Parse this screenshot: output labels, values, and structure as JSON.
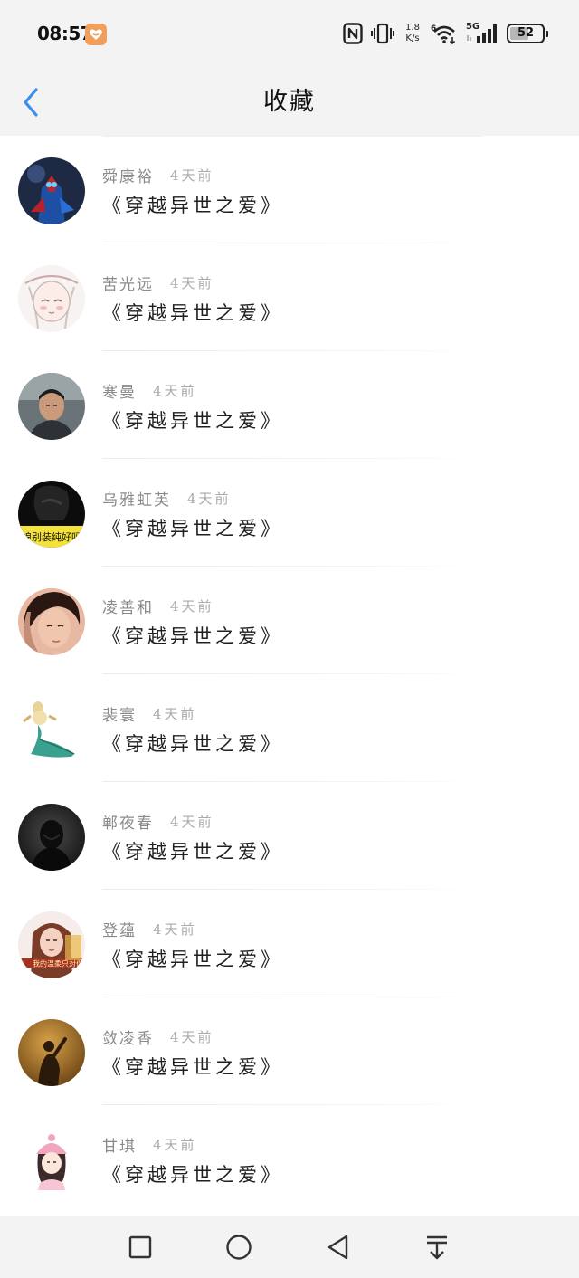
{
  "status_bar": {
    "time": "08:57",
    "net_speed_value": "1.8",
    "net_speed_unit": "K/s",
    "network_type": "5G",
    "battery_percent": "52",
    "icons": [
      "app-notification-icon",
      "nfc-icon",
      "vibrate-icon",
      "wifi-icon",
      "signal-icon",
      "battery-icon"
    ]
  },
  "header": {
    "title": "收藏",
    "back_icon": "chevron-left-icon",
    "accent": "#3a8ef0"
  },
  "items": [
    {
      "name": "舜康裕",
      "time": "4天前",
      "title": "《穿越异世之爱》",
      "avatar": "avatar-armored-hero"
    },
    {
      "name": "苦光远",
      "time": "4天前",
      "title": "《穿越异世之爱》",
      "avatar": "avatar-sketch-girl"
    },
    {
      "name": "寒曼",
      "time": "4天前",
      "title": "《穿越异世之爱》",
      "avatar": "avatar-man-photo"
    },
    {
      "name": "乌雅虹英",
      "time": "4天前",
      "title": "《穿越异世之爱》",
      "avatar": "avatar-dark-caption",
      "avatar_caption": "娘别装纯好吗"
    },
    {
      "name": "凌善和",
      "time": "4天前",
      "title": "《穿越异世之爱》",
      "avatar": "avatar-portrait-boy"
    },
    {
      "name": "裴寰",
      "time": "4天前",
      "title": "《穿越异世之爱》",
      "avatar": "avatar-dancer-cartoon"
    },
    {
      "name": "郸夜春",
      "time": "4天前",
      "title": "《穿越异世之爱》",
      "avatar": "avatar-dark-silhouette"
    },
    {
      "name": "登蕴",
      "time": "4天前",
      "title": "《穿越异世之爱》",
      "avatar": "avatar-girl-caption",
      "avatar_caption": "我的温柔只对你"
    },
    {
      "name": "敛凌香",
      "time": "4天前",
      "title": "《穿越异世之爱》",
      "avatar": "avatar-sunset-silhouette"
    },
    {
      "name": "甘琪",
      "time": "4天前",
      "title": "《穿越异世之爱》",
      "avatar": "avatar-pink-hat-girl"
    }
  ],
  "nav_bar": {
    "icons": [
      "recents-square-icon",
      "home-circle-icon",
      "back-triangle-icon",
      "notification-pull-down-icon"
    ]
  }
}
